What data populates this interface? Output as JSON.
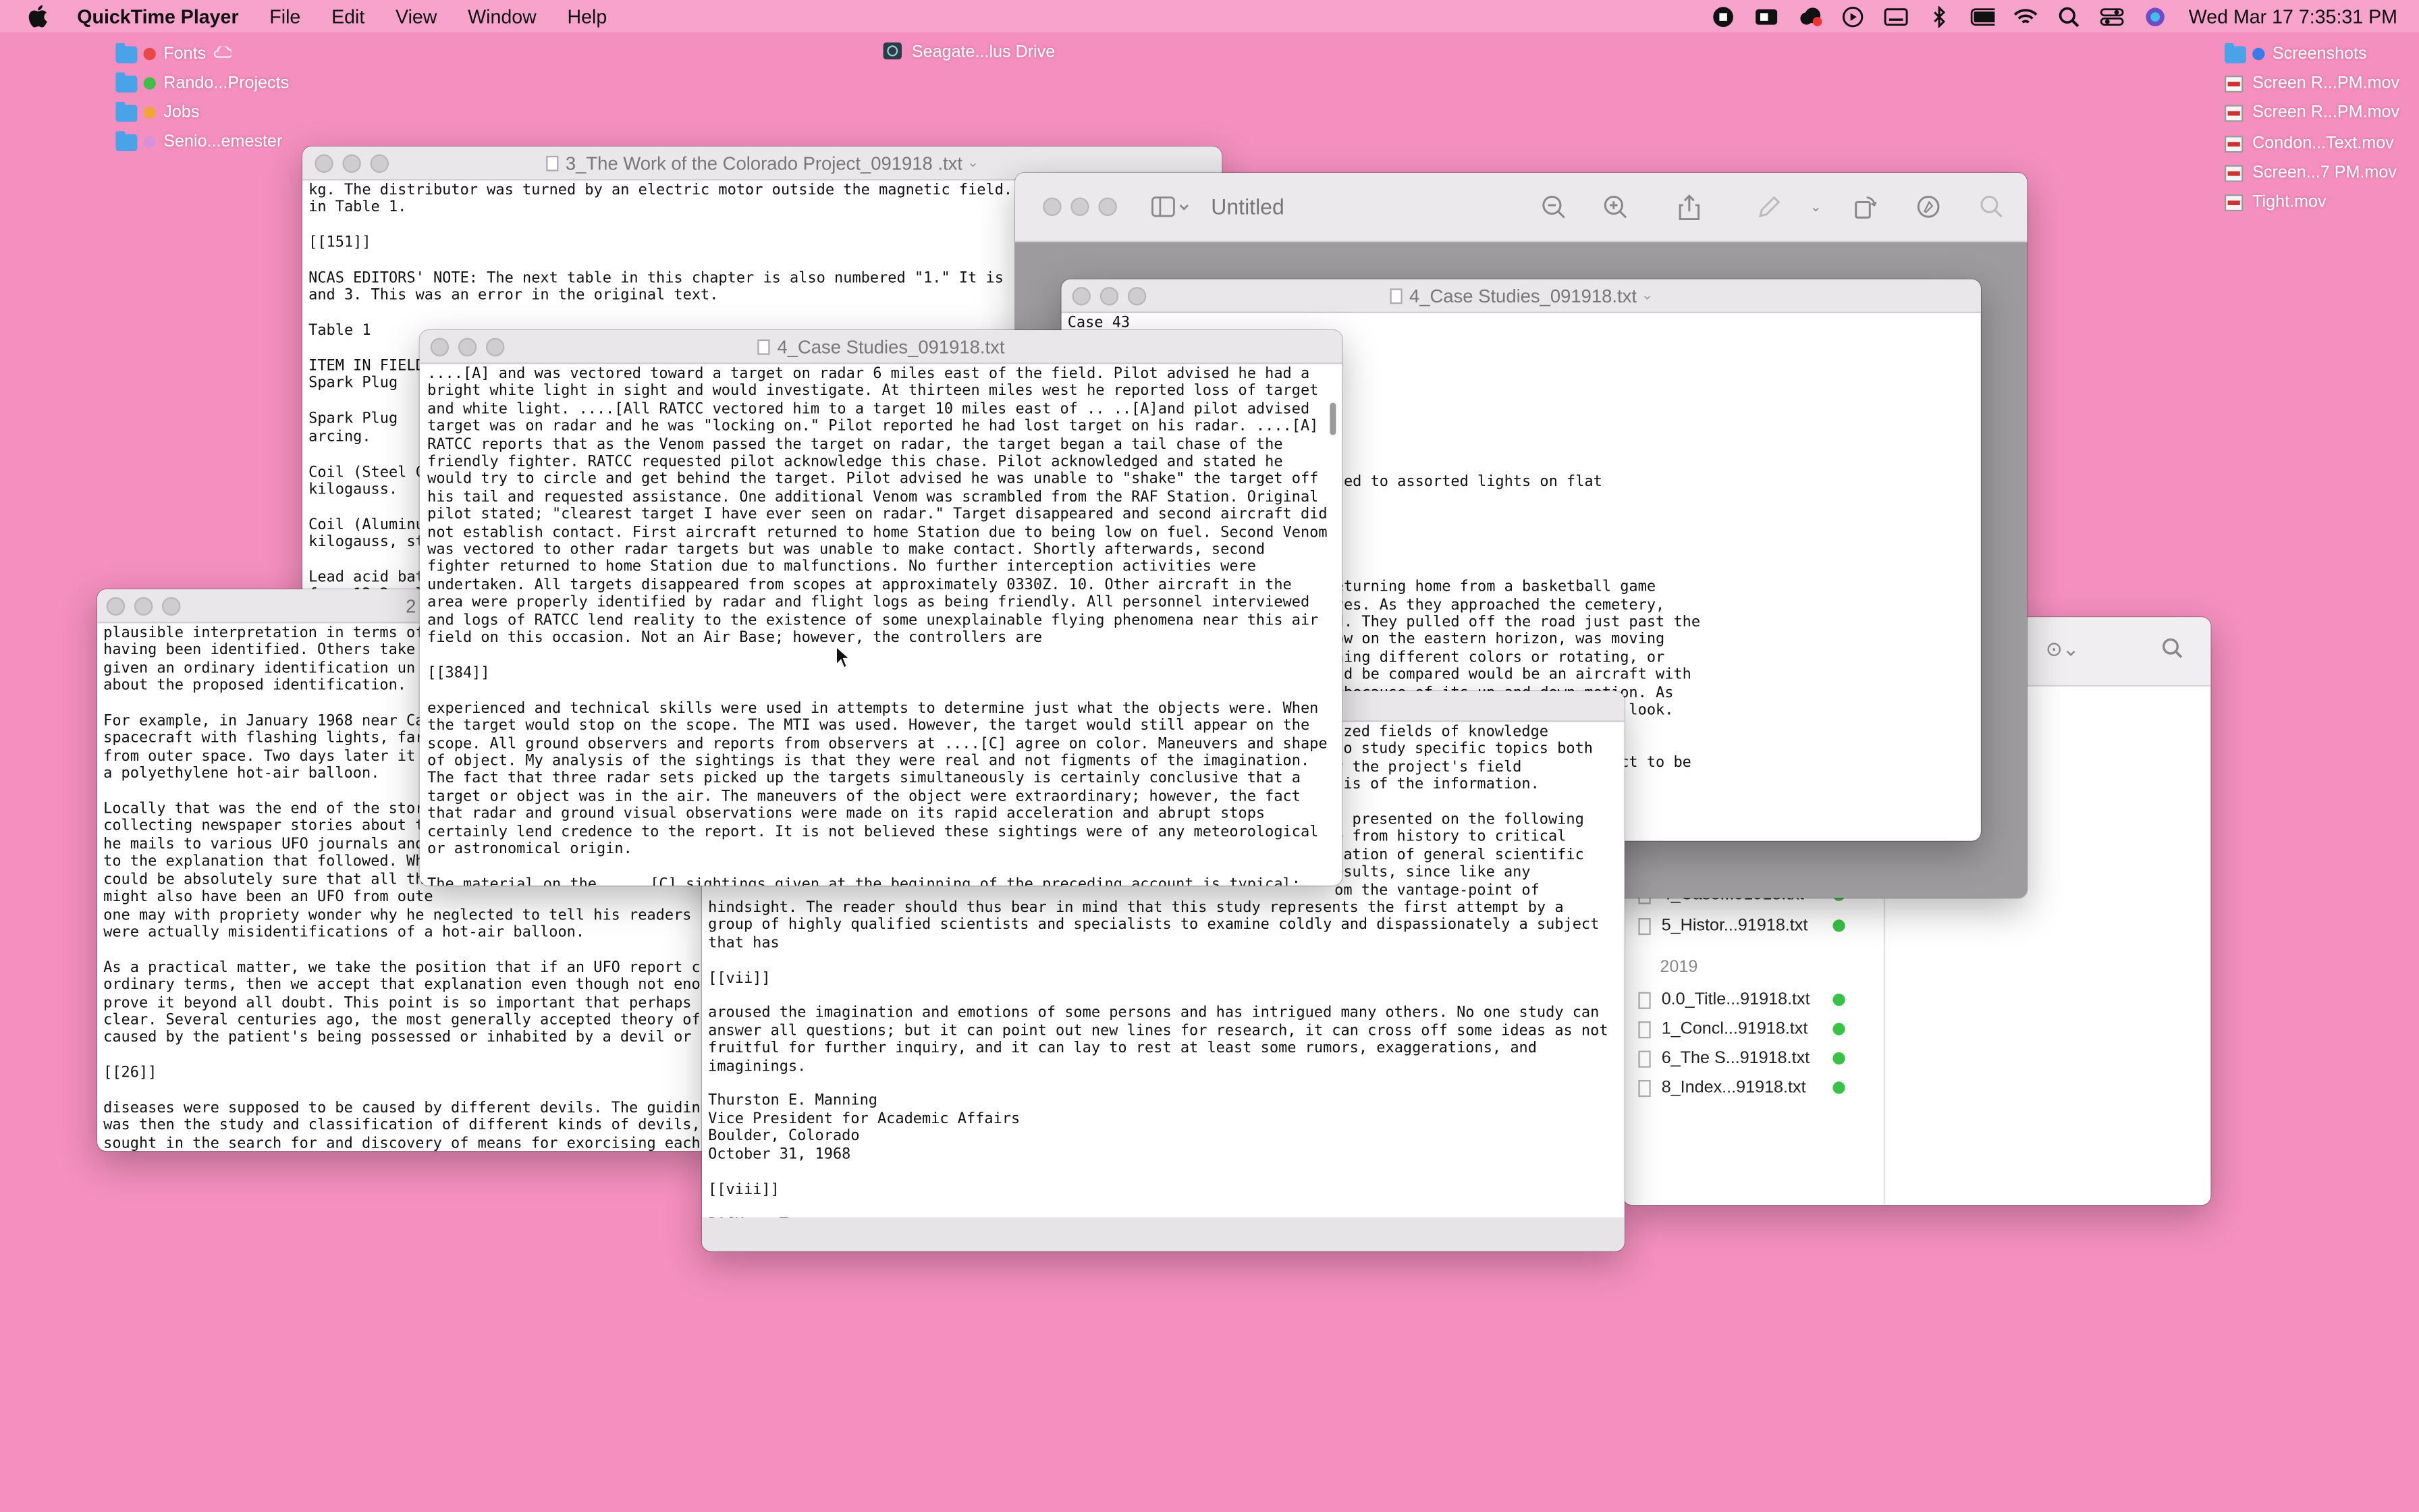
{
  "menubar": {
    "app": "QuickTime Player",
    "items": [
      "File",
      "Edit",
      "View",
      "Window",
      "Help"
    ],
    "datetime": "Wed Mar 17  7:35:31 PM",
    "status_icons": [
      "stop-record-icon",
      "facetime-icon",
      "creative-cloud-icon",
      "play-icon",
      "keyboard-icon",
      "bluetooth-icon",
      "battery-icon",
      "wifi-icon",
      "search-icon",
      "control-center-icon",
      "siri-icon"
    ]
  },
  "desktop_left": [
    {
      "label": "Fonts",
      "tag": "#e8474a",
      "extra": "cloud"
    },
    {
      "label": "Rando...Projects",
      "tag": "#3fbf4a"
    },
    {
      "label": "Jobs",
      "tag": "#f2a33a"
    },
    {
      "label": "Senio...emester",
      "tag": "#d98fd9"
    }
  ],
  "drive": {
    "label": "Seagate...lus Drive"
  },
  "desktop_right": [
    {
      "label": "Screenshots",
      "kind": "folder"
    },
    {
      "label": "Screen R...PM.mov",
      "kind": "mov"
    },
    {
      "label": "Screen R...PM.mov",
      "kind": "mov"
    },
    {
      "label": "Condon...Text.mov",
      "kind": "mov"
    },
    {
      "label": "Screen...7 PM.mov",
      "kind": "mov"
    },
    {
      "label": "Tight.mov",
      "kind": "mov"
    }
  ],
  "windows": {
    "colorado": {
      "title": "3_The Work of the Colorado Project_091918 .txt",
      "text": "kg. The distributor was turned by an electric motor outside the magnetic field.\nin Table 1.\n\n[[151]]\n\nNCAS EDITORS' NOTE: The next table in this chapter is also numbered \"1.\" It is\nand 3. This was an error in the original text.\n\nTable 1\n\nITEM IN FIELD\nSpark Plug\n\nSpark Plug\narcing.\n\nCoil (Steel C\nkilogauss.\n\nCoil (Aluminu\nkilogauss, st\n\nLead acid bat\nfrom 13.2 vol"
    },
    "preview": {
      "title": "Untitled"
    },
    "case_back": {
      "title": "4_Case Studies_091918.txt",
      "text": "Case 43\n\n\n\n\n\n\n\n\nof strange lights were attributed to assorted lights on flat\naft.\n\n\n\n\nDecember 1967, six teenagers returning home from a basketball game\na cemetery to frighten themselves. As they approached the cemetery,\nlinking light in the sky beyond. They pulled off the road just past the\nobstructed view. The object, low on the eastern horizon, was moving\nmotion. It appeared to be flashing different colors or rotating, or\nional object with which it could be compared would be an aircraft with\nwas ruled out by the witnesses because of its up-and-down motion. As\nth, they turned around and followed, hoping to obtain a better look.\nFinally, they came to a location from\nto their left, apparently in a field.\nof distance could not be made, the witnesses believed the object to be\nd follow by using country roads.\n\ns are highly inconsistent with one\nbject for several miles, losing sight\nFinally, they came to a location from\nto their left, apparently in a field.\npossibilities were indicated by the\nld\", some like car lights, some (or\ne, nearly sunlight beams"
    },
    "case_front": {
      "title": "4_Case Studies_091918.txt",
      "text": "....[A] and was vectored toward a target on radar 6 miles east of the field. Pilot advised he had a\nbright white light in sight and would investigate. At thirteen miles west he reported loss of target\nand white light. ....[All RATCC vectored him to a target 10 miles east of .. ..[A]and pilot advised\ntarget was on radar and he was \"locking on.\" Pilot reported he had lost target on his radar. ....[A]\nRATCC reports that as the Venom passed the target on radar, the target began a tail chase of the\nfriendly fighter. RATCC requested pilot acknowledge this chase. Pilot acknowledged and stated he\nwould try to circle and get behind the target. Pilot advised he was unable to \"shake\" the target off\nhis tail and requested assistance. One additional Venom was scrambled from the RAF Station. Original\npilot stated; \"clearest target I have ever seen on radar.\" Target disappeared and second aircraft did\nnot establish contact. First aircraft returned to home Station due to being low on fuel. Second Venom\nwas vectored to other radar targets but was unable to make contact. Shortly afterwards, second\nfighter returned to home Station due to malfunctions. No further interception activities were\nundertaken. All targets disappeared from scopes at approximately 0330Z. 10. Other aircraft in the\narea were properly identified by radar and flight logs as being friendly. All personnel interviewed\nand logs of RATCC lend reality to the existence of some unexplainable flying phenomena near this air\nfield on this occasion. Not an Air Base; however, the controllers are\n\n[[384]]\n\nexperienced and technical skills were used in attempts to determine just what the objects were. When\nthe target would stop on the scope. The MTI was used. However, the target would still appear on the\nscope. All ground observers and reports from observers at ....[C] agree on color. Maneuvers and shape\nof object. My analysis of the sightings is that they were real and not figments of the imagination.\nThe fact that three radar sets picked up the targets simultaneously is certainly conclusive that a\ntarget or object was in the air. The maneuvers of the object were extraordinary; however, the fact\nthat radar and ground visual observations were made on its rapid acceleration and abrupt stops\ncertainly lend credence to the report. It is not believed these sightings were of any meteorological\nor astronomical origin.\n\nThe material on the .... [C] sightings given at the beginning of the preceding account is typical;\nother observers at the sighting at the station."
    },
    "left_doc": {
      "title": "2",
      "text": "plausible interpretation in terms of\nhaving been identified. Others take\ngiven an ordinary identification un\nabout the proposed identification.\n\nFor example, in January 1968 near Ca\nspacecraft with flashing lights, far\nfrom outer space. Two days later it\na polyethylene hot-air balloon.\n\nLocally that was the end of the stor\ncollecting newspaper stories about t\nhe mails to various UFO journals and\nto the explanation that followed. Wh\ncould be absolutely sure that all th\nmight also have been an UFO from oute\none may with propriety wonder why he neglected to tell his readers\nwere actually misidentifications of a hot-air balloon.\n\nAs a practical matter, we take the position that if an UFO report c\nordinary terms, then we accept that explanation even though not eno\nprove it beyond all doubt. This point is so important that perhaps\nclear. Several centuries ago, the most generally accepted theory of\ncaused by the patient's being possessed or inhabited by a devil or\n\n[[26]]\n\ndiseases were supposed to be caused by different devils. The guidin\nwas then the study and classification of different kinds of devils,\nsought in the search for and discovery of means for exorcising each"
    },
    "foreword": {
      "text_top": "ized fields of knowledge\nto study specific topics both\ny the project's field\nsis of the information.\n\ns presented on the following\ne from history to critical\ntation of general scientific\nesults, since like any\nom the vantage-point of",
      "text": "hindsight. The reader should thus bear in mind that this study represents the first attempt by a\ngroup of highly qualified scientists and specialists to examine coldly and dispassionately a subject\nthat has\n\n[[vii]]\n\naroused the imagination and emotions of some persons and has intrigued many others. No one study can\nanswer all questions; but it can point out new lines for research, it can cross off some ideas as not\nfruitful for further inquiry, and it can lay to rest at least some rumors, exaggerations, and\nimaginings.\n\nThurston E. Manning\nVice President for Academic Affairs\nBoulder, Colorado\nOctober 31, 1968\n\n[[viii]]\n\nBACK to Top"
    },
    "finder": {
      "files_top": [
        {
          "name": "4_Case...91918.txt"
        },
        {
          "name": "5_Histor...91918.txt"
        }
      ],
      "group": "2019",
      "files": [
        {
          "name": "0.0_Title...91918.txt"
        },
        {
          "name": "1_Concl...91918.txt"
        },
        {
          "name": "6_The S...91918.txt"
        },
        {
          "name": "8_Index...91918.txt"
        }
      ]
    }
  }
}
